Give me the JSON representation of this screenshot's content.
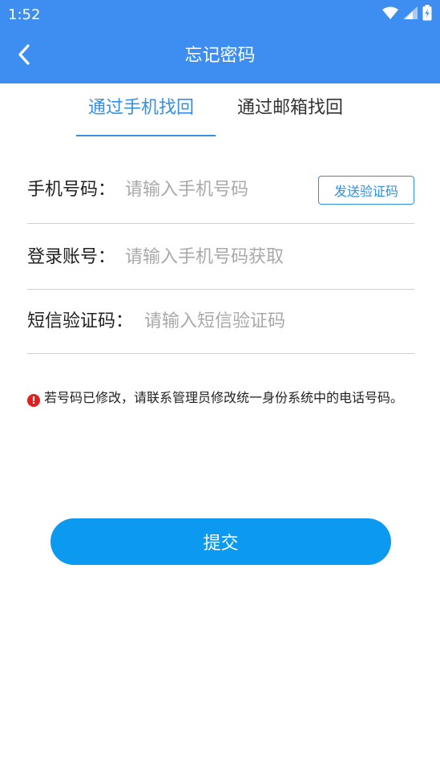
{
  "status_bar": {
    "time": "1:52",
    "icons": [
      "wifi-icon",
      "signal-icon",
      "battery-charging-icon"
    ]
  },
  "nav": {
    "back_icon": "chevron-left-icon",
    "title": "忘记密码"
  },
  "tabs": [
    {
      "label": "通过手机找回",
      "active": true
    },
    {
      "label": "通过邮箱找回",
      "active": false
    }
  ],
  "form": {
    "phone": {
      "label": "手机号码：",
      "placeholder": "请输入手机号码",
      "value": ""
    },
    "send_code_label": "发送验证码",
    "account": {
      "label": "登录账号：",
      "placeholder": "请输入手机号码获取",
      "value": ""
    },
    "sms_code": {
      "label": "短信验证码：",
      "placeholder": "请输入短信验证码",
      "value": ""
    }
  },
  "notice": {
    "icon": "!",
    "text": "若号码已修改，请联系管理员修改统一身份系统中的电话号码。"
  },
  "submit_label": "提交",
  "colors": {
    "header_bg": "#3d8ef0",
    "accent": "#3390e6",
    "submit_bg": "#0b9aef",
    "alert": "#e02020"
  }
}
